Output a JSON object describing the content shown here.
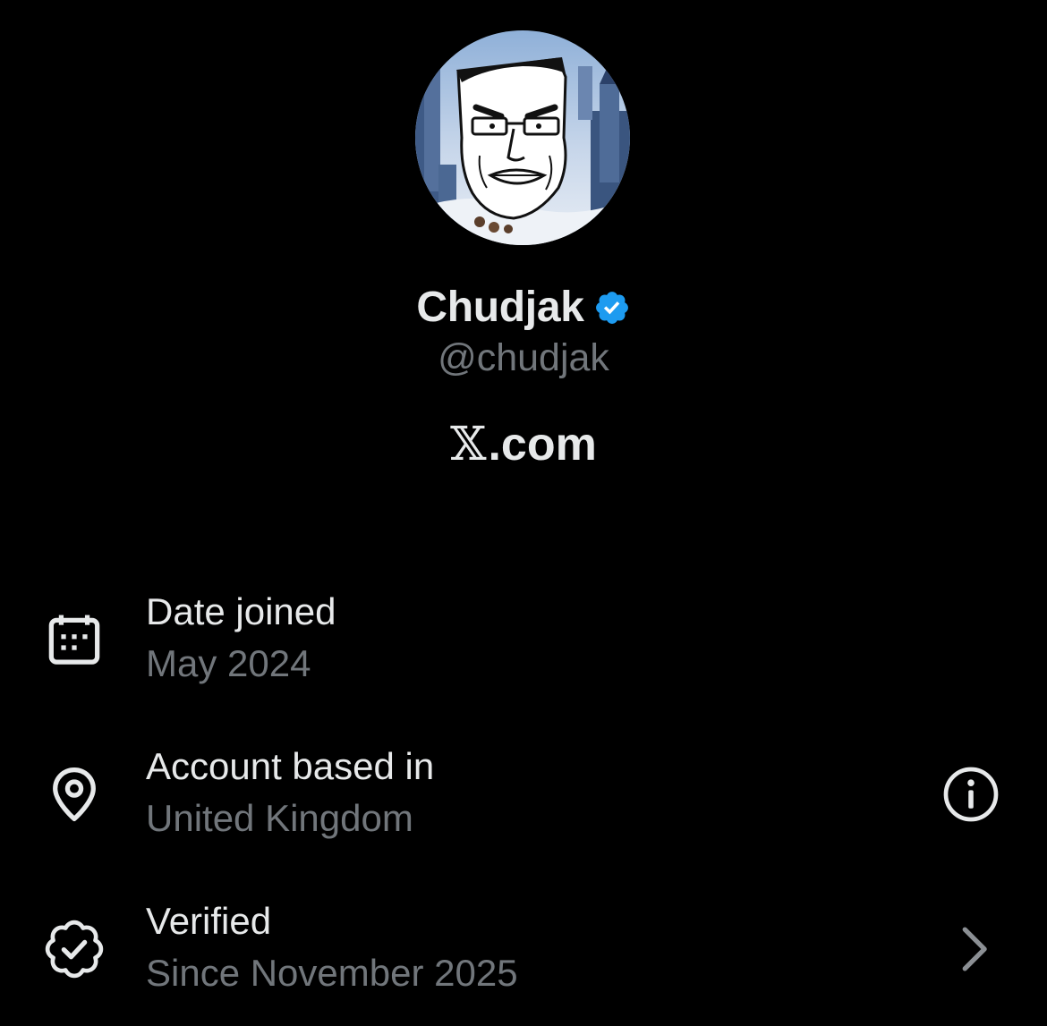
{
  "profile": {
    "display_name": "Chudjak",
    "handle": "@chudjak",
    "brand_suffix": ".com",
    "brand_mark": "𝕏"
  },
  "rows": [
    {
      "icon": "calendar-icon",
      "title": "Date joined",
      "value": "May 2024"
    },
    {
      "icon": "location-pin-icon",
      "title": "Account based in",
      "value": "United Kingdom",
      "action_icon": "info-icon"
    },
    {
      "icon": "verified-badge-icon",
      "title": "Verified",
      "value": "Since November 2025",
      "action_icon": "chevron-right-icon"
    }
  ],
  "colors": {
    "background": "#000000",
    "primary_text": "#e7e9ea",
    "secondary_text": "#71767b",
    "verified_blue": "#1d9bf0"
  }
}
